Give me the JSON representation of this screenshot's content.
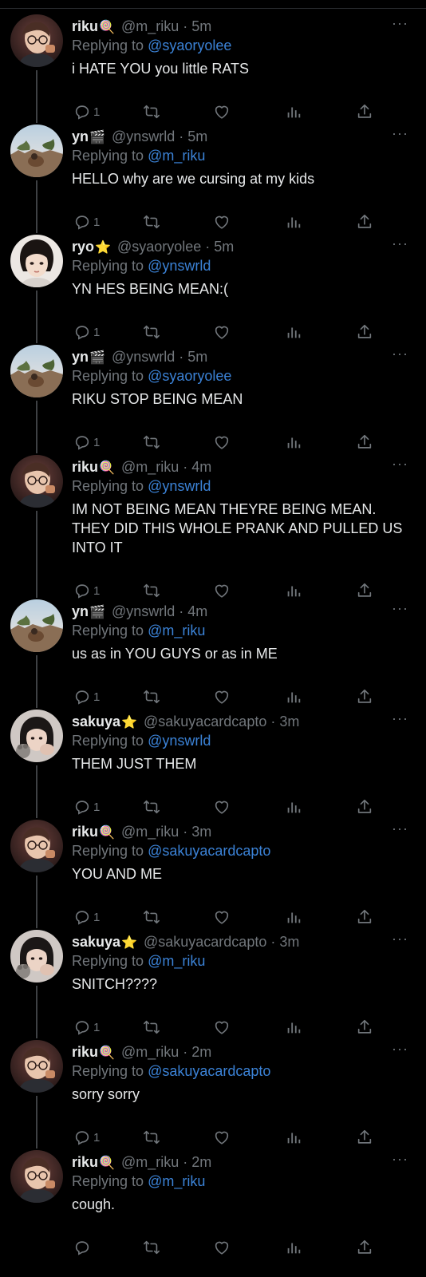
{
  "ui": {
    "more_label": "···",
    "replying_prefix": "Replying to ",
    "separator": "·",
    "colors": {
      "background": "#000000",
      "text": "#e7e9ea",
      "muted": "#71767b",
      "mention": "#3b82d6",
      "thread_line": "#3e4144"
    },
    "icons": [
      "reply-icon",
      "retweet-icon",
      "like-icon",
      "views-icon",
      "share-icon",
      "more-icon"
    ]
  },
  "tweets": [
    {
      "name": "riku",
      "emoji": "🍭",
      "avatar": "riku",
      "handle": "@m_riku",
      "time": "5m",
      "replying_to": "@syaoryolee",
      "lines": [
        "i HATE YOU you little RATS"
      ],
      "reply_count": "1"
    },
    {
      "name": "yn",
      "emoji": "🎬",
      "avatar": "yn",
      "handle": "@ynswrld",
      "time": "5m",
      "replying_to": "@m_riku",
      "lines": [
        "HELLO why are we cursing at my kids"
      ],
      "reply_count": "1"
    },
    {
      "name": "ryo",
      "emoji": "⭐",
      "avatar": "ryo",
      "handle": "@syaoryolee",
      "time": "5m",
      "replying_to": "@ynswrld",
      "lines": [
        "YN HES BEING MEAN:("
      ],
      "reply_count": "1"
    },
    {
      "name": "yn",
      "emoji": "🎬",
      "avatar": "yn",
      "handle": "@ynswrld",
      "time": "5m",
      "replying_to": "@syaoryolee",
      "lines": [
        "RIKU STOP BEING MEAN"
      ],
      "reply_count": "1"
    },
    {
      "name": "riku",
      "emoji": "🍭",
      "avatar": "riku",
      "handle": "@m_riku",
      "time": "4m",
      "replying_to": "@ynswrld",
      "lines": [
        "IM NOT BEING MEAN THEYRE BEING MEAN.",
        "THEY DID THIS WHOLE PRANK AND PULLED US",
        "INTO IT"
      ],
      "reply_count": "1"
    },
    {
      "name": "yn",
      "emoji": "🎬",
      "avatar": "yn",
      "handle": "@ynswrld",
      "time": "4m",
      "replying_to": "@m_riku",
      "lines": [
        "us as in YOU GUYS or as in ME"
      ],
      "reply_count": "1"
    },
    {
      "name": "sakuya",
      "emoji": "⭐",
      "avatar": "sakuya",
      "handle": "@sakuyacardcapto",
      "time": "3m",
      "replying_to": "@ynswrld",
      "lines": [
        "THEM JUST THEM"
      ],
      "reply_count": "1"
    },
    {
      "name": "riku",
      "emoji": "🍭",
      "avatar": "riku",
      "handle": "@m_riku",
      "time": "3m",
      "replying_to": "@sakuyacardcapto",
      "lines": [
        "YOU AND ME"
      ],
      "reply_count": "1"
    },
    {
      "name": "sakuya",
      "emoji": "⭐",
      "avatar": "sakuya",
      "handle": "@sakuyacardcapto",
      "time": "3m",
      "replying_to": "@m_riku",
      "lines": [
        "SNITCH????"
      ],
      "reply_count": "1"
    },
    {
      "name": "riku",
      "emoji": "🍭",
      "avatar": "riku",
      "handle": "@m_riku",
      "time": "2m",
      "replying_to": "@sakuyacardcapto",
      "lines": [
        "sorry sorry"
      ],
      "reply_count": "1"
    },
    {
      "name": "riku",
      "emoji": "🍭",
      "avatar": "riku",
      "handle": "@m_riku",
      "time": "2m",
      "replying_to": "@m_riku",
      "lines": [
        "cough."
      ],
      "reply_count": ""
    }
  ]
}
